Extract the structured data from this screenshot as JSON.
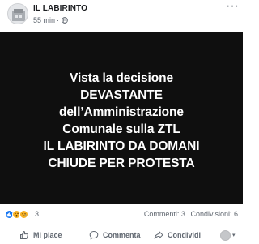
{
  "header": {
    "page_name": "IL LABIRINTO",
    "time": "55 min",
    "dot": "·",
    "more": "···"
  },
  "post": {
    "lines": [
      "Vista la decisione",
      "DEVASTANTE",
      "dell’Amministrazione",
      "Comunale sulla ZTL",
      "IL LABIRINTO DA DOMANI",
      "CHIUDE PER PROTESTA"
    ],
    "background": "#0f0f0f",
    "text_color": "#ffffff"
  },
  "reactions": {
    "icons": [
      "like-icon",
      "wow-icon",
      "sad-icon"
    ],
    "count": "3",
    "comments": "Commenti: 3",
    "shares": "Condivisioni: 6"
  },
  "actions": {
    "like": "Mi piace",
    "comment": "Commenta",
    "share": "Condividi",
    "caret": "▾"
  },
  "colors": {
    "accent": "#1877f2",
    "secondary_text": "#606770",
    "primary_text": "#1c1e21"
  }
}
